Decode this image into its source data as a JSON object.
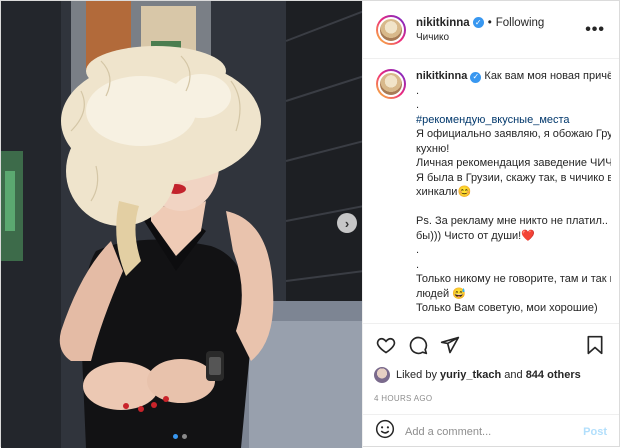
{
  "header": {
    "username": "nikitkinna",
    "separator": "•",
    "follow_status": "Following",
    "location": "Чичико",
    "more": "•••"
  },
  "caption": {
    "username": "nikitkinna",
    "first_text": "Как вам моя новая причёска",
    "lines": [
      ".",
      ".",
      "#рекомендую_вкусные_места",
      "Я официально заявляю, я обожаю Грузи",
      "кухню!",
      "Личная рекомендация заведение ЧИЧИ",
      "Я была в Грузии, скажу так, в чичико вк",
      "хинкали😊",
      "",
      "Ps. За рекламу мне никто не платил.. 😆",
      "бы))) Чисто от души!❤️",
      ".",
      ".",
      "Только никому не говорите, там и так в",
      "людей 😅",
      "Только Вам советую, мои хорошие)"
    ]
  },
  "actions": {
    "icons": [
      "heart-icon",
      "comment-icon",
      "share-icon",
      "bookmark-icon"
    ]
  },
  "likes": {
    "prefix": "Liked by",
    "user": "yuriy_tkach",
    "middle": "and",
    "count": "844 others"
  },
  "timestamp": "4 HOURS AGO",
  "comment": {
    "placeholder": "Add a comment...",
    "post_label": "Post"
  },
  "carousel": {
    "next": "›",
    "total": 2,
    "current": 1
  },
  "colors": {
    "accent": "#3897f0",
    "hashtag": "#00376b",
    "post_disabled": "#b2dffc"
  }
}
